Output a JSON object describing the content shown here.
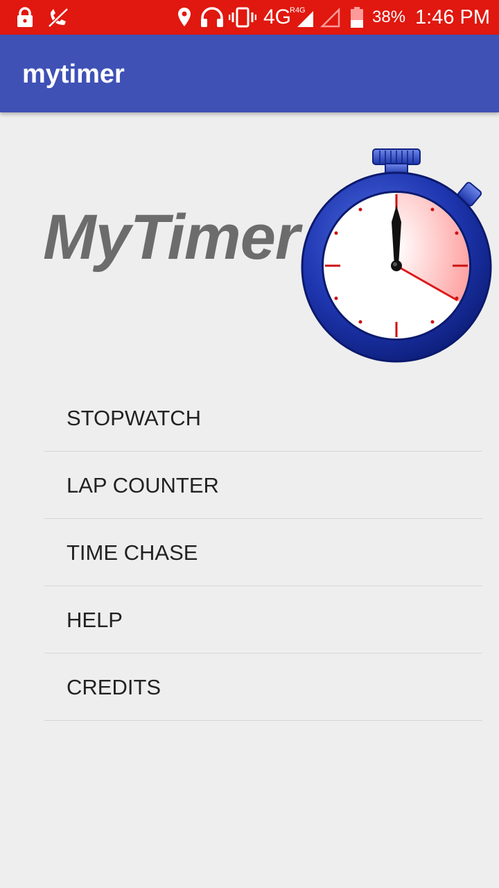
{
  "status_bar": {
    "network": "4G",
    "network_sub": "R4G",
    "battery": "38%",
    "time": "1:46 PM",
    "color": "#e0180f",
    "icons": [
      "lock-icon",
      "missed-call-icon",
      "location-icon",
      "headset-icon",
      "vibrate-icon",
      "signal-icon",
      "signal-empty-icon",
      "battery-icon"
    ]
  },
  "app_bar": {
    "title": "mytimer",
    "color": "#3f51b5"
  },
  "hero": {
    "title": "MyTimer",
    "image": "stopwatch-icon"
  },
  "menu": {
    "items": [
      {
        "label": "STOPWATCH"
      },
      {
        "label": "LAP COUNTER"
      },
      {
        "label": "TIME CHASE"
      },
      {
        "label": "HELP"
      },
      {
        "label": "CREDITS"
      }
    ]
  }
}
